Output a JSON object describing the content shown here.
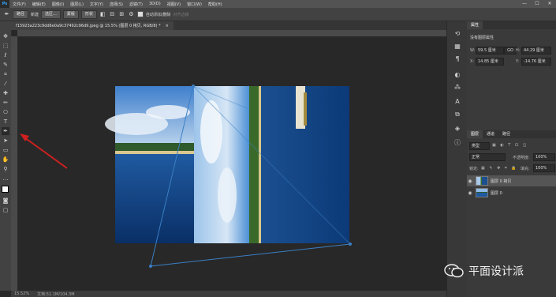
{
  "menubar": {
    "app_logo": "Ps",
    "items": [
      "文件(F)",
      "编辑(E)",
      "图像(I)",
      "图层(L)",
      "文字(Y)",
      "选择(S)",
      "滤镜(T)",
      "3D(D)",
      "视图(V)",
      "窗口(W)",
      "帮助(H)"
    ],
    "win_minimize": "—",
    "win_maximize": "☐",
    "win_close": "✕"
  },
  "options": {
    "mode_select": "新建",
    "shape_select": "路径",
    "make_button": "选区...",
    "mask_button": "蒙版",
    "shape_button": "形状",
    "auto_add_delete": "自动添加/删除",
    "align_edges": "对齐边缘"
  },
  "document": {
    "tab_title": "f15923a223c9dd6e0a9c37492c96d9.jpeg @ 15.5% (图层 0 拷贝, RGB/8) *",
    "tab_close": "×",
    "zoom": "15.52%",
    "doc_info": "文档:51.1M/104.3M"
  },
  "properties": {
    "tab_label": "属性",
    "subtitle": "没有图层属性",
    "w_label": "W:",
    "w_value": "59.5 厘米",
    "link_label": "GO",
    "h_label": "H:",
    "h_value": "44.29 厘米",
    "x_label": "X:",
    "x_value": "14.85 厘米",
    "y_label": "Y:",
    "y_value": "-14.76 厘米"
  },
  "layers": {
    "tabs": [
      "图层",
      "通道",
      "路径"
    ],
    "filter_kind": "类型",
    "blend_mode": "正常",
    "opacity_label": "不透明度:",
    "opacity_value": "100%",
    "lock_label": "锁定:",
    "fill_label": "填充:",
    "fill_value": "100%",
    "items": [
      {
        "name": "图层 0 拷贝",
        "visible": "◉",
        "selected": true
      },
      {
        "name": "图层 0",
        "visible": "◉",
        "selected": false
      }
    ],
    "bottom_icons": "⊖ fx ◑ ◻ ▭ ⊞ 🗑"
  },
  "watermark": {
    "text": "平面设计派"
  },
  "colors": {
    "accent": "#31a8ff",
    "arrow": "#d02020",
    "path": "#3a7fc4"
  }
}
